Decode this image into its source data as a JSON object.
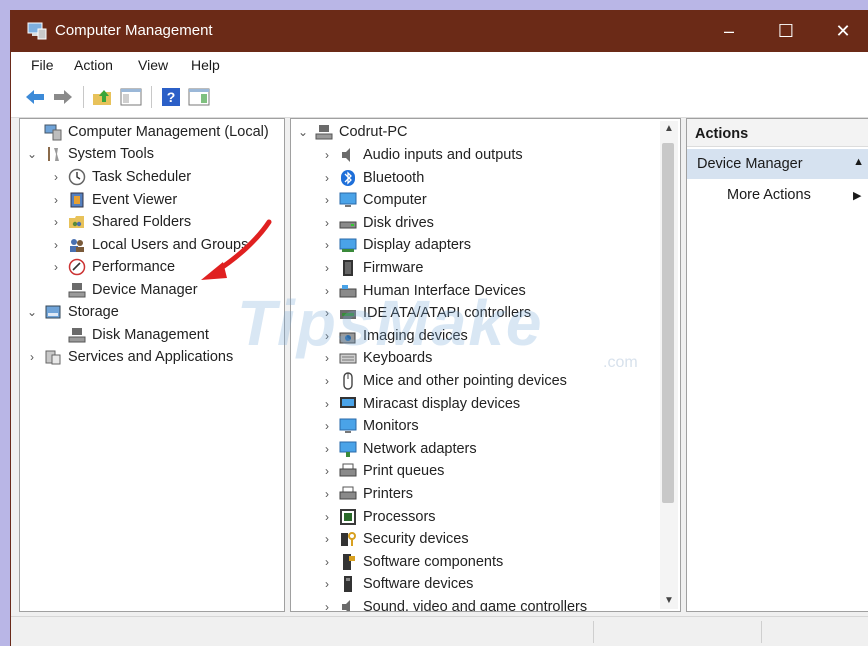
{
  "window": {
    "title": "Computer Management",
    "controls": {
      "minimize": "–",
      "maximize": "☐",
      "close": "✕"
    }
  },
  "menu": [
    "File",
    "Action",
    "View",
    "Help"
  ],
  "colors": {
    "titlebar": "#6b2a17",
    "selection": "#d6e2f0",
    "annotation_arrow": "#e02020"
  },
  "left_tree": [
    {
      "label": "Computer Management (Local)",
      "icon": "computer-management-icon",
      "chevron": ""
    },
    {
      "label": "System Tools",
      "icon": "tools-icon",
      "chevron": "⌄"
    },
    {
      "label": "Task Scheduler",
      "icon": "clock-icon",
      "chevron": "›"
    },
    {
      "label": "Event Viewer",
      "icon": "event-viewer-icon",
      "chevron": "›"
    },
    {
      "label": "Shared Folders",
      "icon": "shared-folder-icon",
      "chevron": "›"
    },
    {
      "label": "Local Users and Groups",
      "icon": "users-icon",
      "chevron": "›"
    },
    {
      "label": "Performance",
      "icon": "performance-icon",
      "chevron": "›"
    },
    {
      "label": "Device Manager",
      "icon": "device-manager-icon",
      "chevron": ""
    },
    {
      "label": "Storage",
      "icon": "storage-icon",
      "chevron": "⌄"
    },
    {
      "label": "Disk Management",
      "icon": "disk-icon",
      "chevron": ""
    },
    {
      "label": "Services and Applications",
      "icon": "services-icon",
      "chevron": "›"
    }
  ],
  "device_tree": {
    "root": {
      "label": "Codrut-PC",
      "chevron": "⌄",
      "icon": "pc-icon"
    },
    "items": [
      {
        "label": "Audio inputs and outputs",
        "icon": "speaker-icon"
      },
      {
        "label": "Bluetooth",
        "icon": "bluetooth-icon"
      },
      {
        "label": "Computer",
        "icon": "monitor-icon"
      },
      {
        "label": "Disk drives",
        "icon": "disk-drive-icon"
      },
      {
        "label": "Display adapters",
        "icon": "display-adapter-icon"
      },
      {
        "label": "Firmware",
        "icon": "firmware-icon"
      },
      {
        "label": "Human Interface Devices",
        "icon": "hid-icon"
      },
      {
        "label": "IDE ATA/ATAPI controllers",
        "icon": "ide-icon"
      },
      {
        "label": "Imaging devices",
        "icon": "camera-icon"
      },
      {
        "label": "Keyboards",
        "icon": "keyboard-icon"
      },
      {
        "label": "Mice and other pointing devices",
        "icon": "mouse-icon"
      },
      {
        "label": "Miracast display devices",
        "icon": "miracast-icon"
      },
      {
        "label": "Monitors",
        "icon": "monitor-icon"
      },
      {
        "label": "Network adapters",
        "icon": "network-icon"
      },
      {
        "label": "Print queues",
        "icon": "printer-icon"
      },
      {
        "label": "Printers",
        "icon": "printer-icon"
      },
      {
        "label": "Processors",
        "icon": "processor-icon"
      },
      {
        "label": "Security devices",
        "icon": "security-icon"
      },
      {
        "label": "Software components",
        "icon": "software-component-icon"
      },
      {
        "label": "Software devices",
        "icon": "software-device-icon"
      },
      {
        "label": "Sound, video and game controllers",
        "icon": "sound-icon"
      }
    ]
  },
  "actions": {
    "header": "Actions",
    "section": "Device Manager",
    "more": "More Actions"
  },
  "watermark": {
    "text": "TipsMake",
    "suffix": ".com"
  }
}
